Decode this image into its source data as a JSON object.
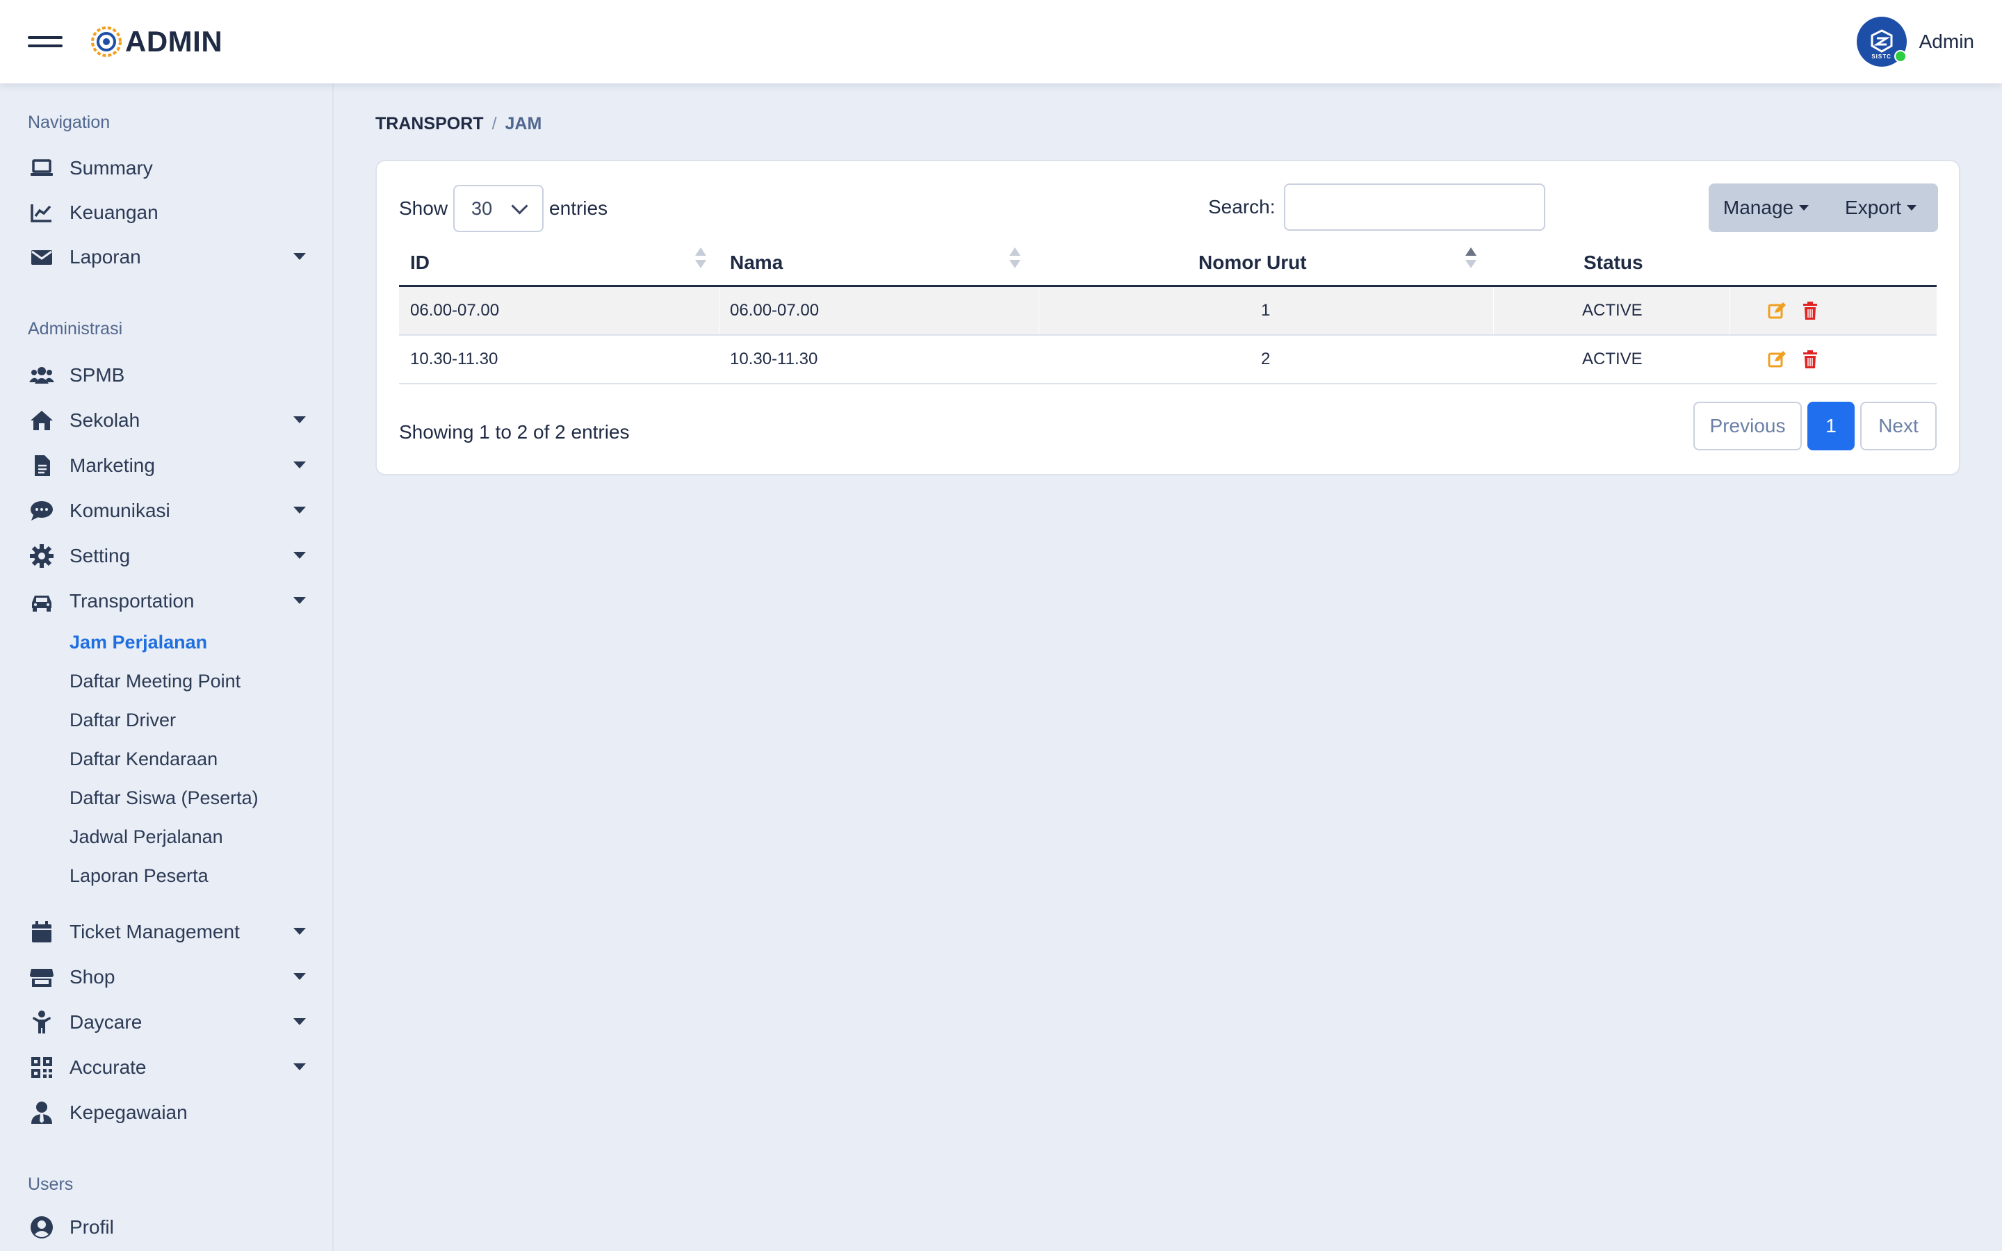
{
  "app": {
    "logo_text": "ADMIN",
    "user_name": "Admin",
    "avatar_text": "SISTC"
  },
  "sidebar": {
    "section_navigation": "Navigation",
    "section_admin": "Administrasi",
    "section_users": "Users",
    "nav": [
      {
        "label": "Summary",
        "icon": "laptop-icon"
      },
      {
        "label": "Keuangan",
        "icon": "chart-line-icon"
      },
      {
        "label": "Laporan",
        "icon": "envelope-icon"
      }
    ],
    "admin": [
      {
        "label": "SPMB",
        "icon": "users-icon"
      },
      {
        "label": "Sekolah",
        "icon": "home-icon"
      },
      {
        "label": "Marketing",
        "icon": "file-icon"
      },
      {
        "label": "Komunikasi",
        "icon": "comment-icon"
      },
      {
        "label": "Setting",
        "icon": "gear-icon"
      },
      {
        "label": "Transportation",
        "icon": "car-icon"
      }
    ],
    "transport_sub": [
      "Jam Perjalanan",
      "Daftar Meeting Point",
      "Daftar Driver",
      "Daftar Kendaraan",
      "Daftar Siswa (Peserta)",
      "Jadwal Perjalanan",
      "Laporan Peserta"
    ],
    "admin2": [
      {
        "label": "Ticket Management",
        "icon": "calendar-icon"
      },
      {
        "label": "Shop",
        "icon": "store-icon"
      },
      {
        "label": "Daycare",
        "icon": "child-icon"
      },
      {
        "label": "Accurate",
        "icon": "qrcode-icon"
      },
      {
        "label": "Kepegawaian",
        "icon": "user-tie-icon"
      }
    ],
    "users": [
      {
        "label": "Profil",
        "icon": "user-circle-icon"
      }
    ]
  },
  "breadcrumb": {
    "parent": "TRANSPORT",
    "separator": "/",
    "current": "JAM"
  },
  "table_controls": {
    "show_label": "Show",
    "entries_value": "30",
    "entries_label": "entries",
    "search_label": "Search:",
    "search_value": "",
    "manage_label": "Manage",
    "export_label": "Export"
  },
  "table": {
    "headers": [
      "ID",
      "Nama",
      "Nomor Urut",
      "Status"
    ],
    "rows": [
      {
        "id": "06.00-07.00",
        "nama": "06.00-07.00",
        "nomor": "1",
        "status": "ACTIVE"
      },
      {
        "id": "10.30-11.30",
        "nama": "10.30-11.30",
        "nomor": "2",
        "status": "ACTIVE"
      }
    ]
  },
  "pagination": {
    "info": "Showing 1 to 2 of 2 entries",
    "previous": "Previous",
    "current": "1",
    "next": "Next"
  },
  "colors": {
    "accent": "#1f6fee",
    "edit": "#f0a020",
    "delete": "#e02424",
    "active_link": "#1f6fe0"
  }
}
